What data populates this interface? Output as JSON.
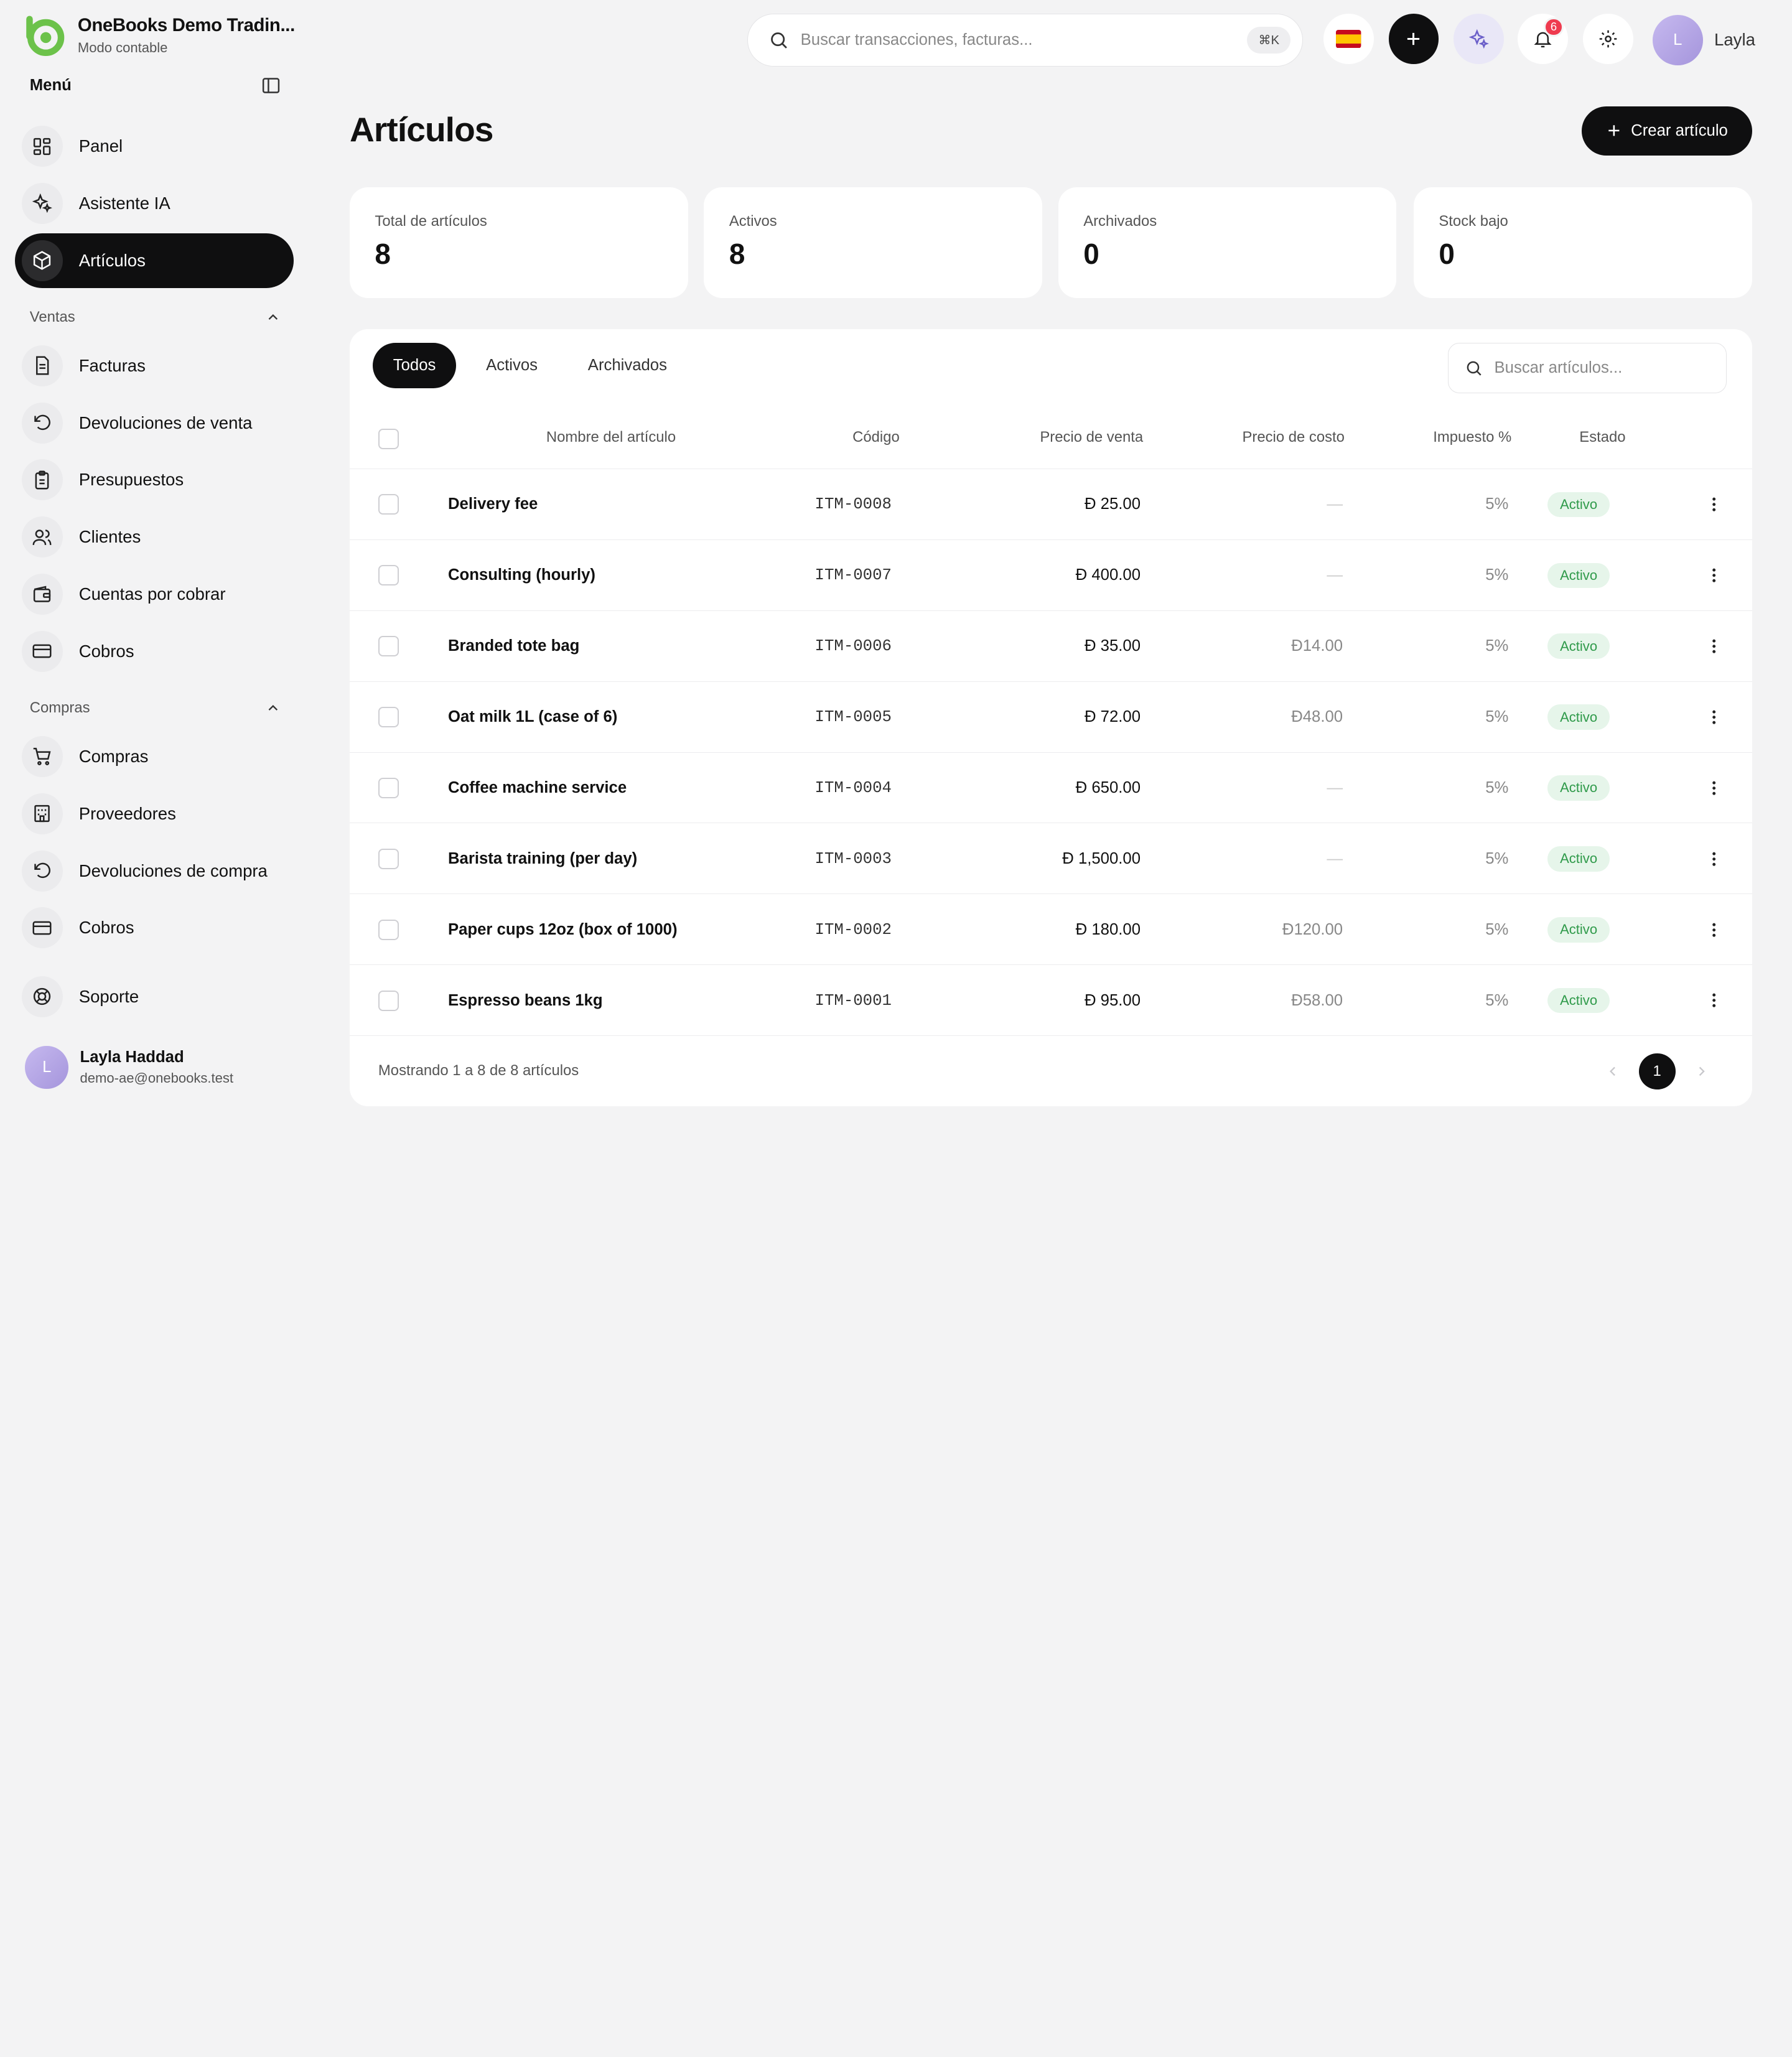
{
  "brand": {
    "name": "OneBooks Demo Tradin...",
    "subtitle": "Modo contable"
  },
  "sidebar": {
    "menu_label": "Menú",
    "top_items": [
      {
        "label": "Panel",
        "icon": "dashboard-icon"
      },
      {
        "label": "Asistente IA",
        "icon": "sparkles-icon"
      },
      {
        "label": "Artículos",
        "icon": "box-icon",
        "active": true
      }
    ],
    "sales": {
      "label": "Ventas",
      "items": [
        {
          "label": "Facturas",
          "icon": "document-icon"
        },
        {
          "label": "Devoluciones de venta",
          "icon": "undo-icon"
        },
        {
          "label": "Presupuestos",
          "icon": "clipboard-icon"
        },
        {
          "label": "Clientes",
          "icon": "users-icon"
        },
        {
          "label": "Cuentas por cobrar",
          "icon": "wallet-icon"
        },
        {
          "label": "Cobros",
          "icon": "card-icon"
        }
      ]
    },
    "purchases": {
      "label": "Compras",
      "items": [
        {
          "label": "Compras",
          "icon": "cart-icon"
        },
        {
          "label": "Proveedores",
          "icon": "building-icon"
        },
        {
          "label": "Devoluciones de compra",
          "icon": "undo-icon"
        },
        {
          "label": "Cobros",
          "icon": "card-icon"
        }
      ]
    },
    "support": {
      "label": "Soporte",
      "icon": "lifebuoy-icon"
    },
    "user": {
      "initial": "L",
      "name": "Layla Haddad",
      "email": "demo-ae@onebooks.test"
    }
  },
  "topbar": {
    "search_placeholder": "Buscar transacciones, facturas...",
    "shortcut": "⌘K",
    "notifications_count": "6",
    "user_initial": "L",
    "user_name": "Layla"
  },
  "page": {
    "title": "Artículos",
    "create_label": "Crear artículo"
  },
  "stats": [
    {
      "label": "Total de artículos",
      "value": "8"
    },
    {
      "label": "Activos",
      "value": "8"
    },
    {
      "label": "Archivados",
      "value": "0"
    },
    {
      "label": "Stock bajo",
      "value": "0"
    }
  ],
  "tabs": [
    "Todos",
    "Activos",
    "Archivados"
  ],
  "table_search_placeholder": "Buscar artículos...",
  "columns": {
    "name": "Nombre del artículo",
    "code": "Código",
    "sale": "Precio de venta",
    "cost": "Precio de costo",
    "tax": "Impuesto %",
    "status": "Estado"
  },
  "currency_symbol": "Đ",
  "rows": [
    {
      "name": "Delivery fee",
      "code": "ITM-0008",
      "sale": "25.00",
      "cost": "",
      "tax": "5%",
      "status": "Activo"
    },
    {
      "name": "Consulting (hourly)",
      "code": "ITM-0007",
      "sale": "400.00",
      "cost": "",
      "tax": "5%",
      "status": "Activo"
    },
    {
      "name": "Branded tote bag",
      "code": "ITM-0006",
      "sale": "35.00",
      "cost": "14.00",
      "tax": "5%",
      "status": "Activo"
    },
    {
      "name": "Oat milk 1L (case of 6)",
      "code": "ITM-0005",
      "sale": "72.00",
      "cost": "48.00",
      "tax": "5%",
      "status": "Activo"
    },
    {
      "name": "Coffee machine service",
      "code": "ITM-0004",
      "sale": "650.00",
      "cost": "",
      "tax": "5%",
      "status": "Activo"
    },
    {
      "name": "Barista training (per day)",
      "code": "ITM-0003",
      "sale": "1,500.00",
      "cost": "",
      "tax": "5%",
      "status": "Activo"
    },
    {
      "name": "Paper cups 12oz (box of 1000)",
      "code": "ITM-0002",
      "sale": "180.00",
      "cost": "120.00",
      "tax": "5%",
      "status": "Activo"
    },
    {
      "name": "Espresso beans 1kg",
      "code": "ITM-0001",
      "sale": "95.00",
      "cost": "58.00",
      "tax": "5%",
      "status": "Activo"
    }
  ],
  "empty_cost": "—",
  "footer": {
    "showing": "Mostrando 1 a 8 de 8 artículos",
    "page": "1"
  }
}
